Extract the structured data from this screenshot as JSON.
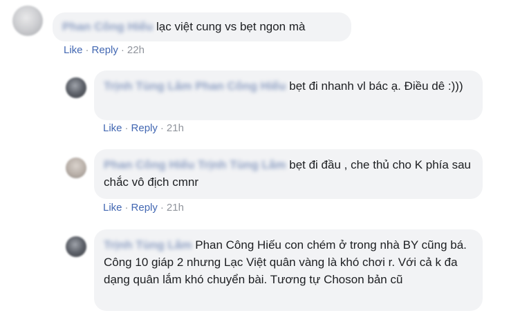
{
  "comments": [
    {
      "author": "Phan Công Hiếu",
      "text": "lạc việt cung vs bẹt ngon mà",
      "like": "Like",
      "reply": "Reply",
      "time": "22h"
    },
    {
      "author": "Trịnh Tùng Lâm",
      "tag": "Phan Công Hiếu",
      "text": "bẹt đi nhanh vl bác ạ. Điều dê :)))",
      "like": "Like",
      "reply": "Reply",
      "time": "21h"
    },
    {
      "author": "Phan Công Hiếu",
      "tag": "Trịnh Tùng Lâm",
      "text": "bẹt đi đầu , che thủ cho K phía sau chắc vô địch cmnr",
      "like": "Like",
      "reply": "Reply",
      "time": "21h"
    },
    {
      "author": "Trịnh Tùng Lâm",
      "text": "Phan Công Hiếu con chém ở trong nhà BY cũng bá. Công 10 giáp 2 nhưng Lạc Việt quân vàng là khó chơi r. Với cả k đa dạng quân lắm khó chuyển bài. Tương tự Choson bản cũ"
    }
  ],
  "separator": "·"
}
